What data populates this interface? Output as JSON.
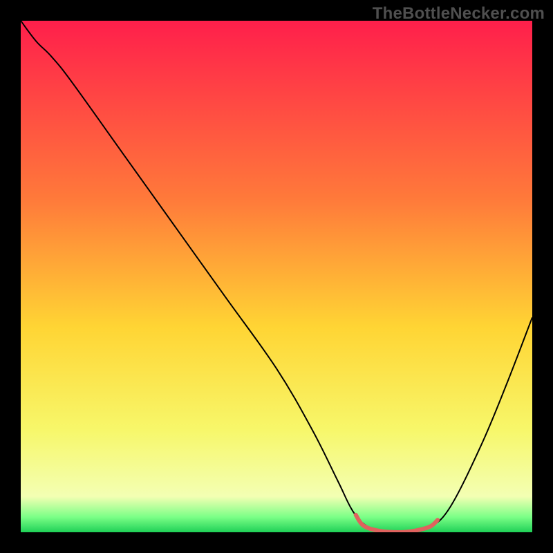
{
  "watermark": "TheBottleNecker.com",
  "chart_data": {
    "type": "line",
    "title": "",
    "xlabel": "",
    "ylabel": "",
    "xlim": [
      0,
      100
    ],
    "ylim": [
      0,
      100
    ],
    "gradient_stops": [
      {
        "offset": 0,
        "color": "#ff1f4b"
      },
      {
        "offset": 35,
        "color": "#ff7a3a"
      },
      {
        "offset": 60,
        "color": "#ffd534"
      },
      {
        "offset": 80,
        "color": "#f7f76a"
      },
      {
        "offset": 93,
        "color": "#f3ffb3"
      },
      {
        "offset": 97,
        "color": "#7cff87"
      },
      {
        "offset": 100,
        "color": "#1fd157"
      }
    ],
    "series": [
      {
        "name": "curve",
        "color": "#000000",
        "points": [
          {
            "x": 0,
            "y": 100
          },
          {
            "x": 3,
            "y": 96
          },
          {
            "x": 6,
            "y": 93
          },
          {
            "x": 10,
            "y": 88
          },
          {
            "x": 20,
            "y": 74
          },
          {
            "x": 30,
            "y": 60
          },
          {
            "x": 40,
            "y": 46
          },
          {
            "x": 50,
            "y": 32
          },
          {
            "x": 57,
            "y": 20
          },
          {
            "x": 62,
            "y": 10
          },
          {
            "x": 65,
            "y": 4
          },
          {
            "x": 68,
            "y": 1
          },
          {
            "x": 72,
            "y": 0
          },
          {
            "x": 76,
            "y": 0
          },
          {
            "x": 80,
            "y": 1
          },
          {
            "x": 84,
            "y": 5
          },
          {
            "x": 90,
            "y": 17
          },
          {
            "x": 95,
            "y": 29
          },
          {
            "x": 100,
            "y": 42
          }
        ]
      }
    ],
    "trough_segment": {
      "color": "#e0625e",
      "width": 6,
      "points": [
        {
          "x": 65.5,
          "y": 3.4
        },
        {
          "x": 67,
          "y": 1.3
        },
        {
          "x": 70,
          "y": 0.3
        },
        {
          "x": 74,
          "y": 0
        },
        {
          "x": 77,
          "y": 0.3
        },
        {
          "x": 80,
          "y": 1.1
        },
        {
          "x": 81.5,
          "y": 2.4
        }
      ]
    }
  }
}
